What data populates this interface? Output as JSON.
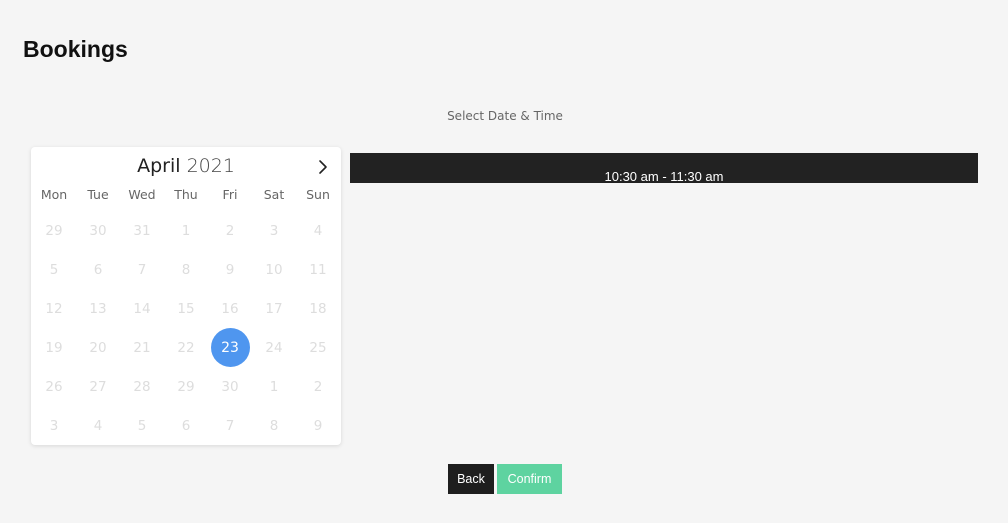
{
  "page": {
    "title": "Bookings"
  },
  "section": {
    "label": "Select Date & Time"
  },
  "calendar": {
    "month": "April",
    "year": "2021",
    "next_icon": "chevron-right-icon",
    "weekdays": [
      "Mon",
      "Tue",
      "Wed",
      "Thu",
      "Fri",
      "Sat",
      "Sun"
    ],
    "weeks": [
      [
        "29",
        "30",
        "31",
        "1",
        "2",
        "3",
        "4"
      ],
      [
        "5",
        "6",
        "7",
        "8",
        "9",
        "10",
        "11"
      ],
      [
        "12",
        "13",
        "14",
        "15",
        "16",
        "17",
        "18"
      ],
      [
        "19",
        "20",
        "21",
        "22",
        "23",
        "24",
        "25"
      ],
      [
        "26",
        "27",
        "28",
        "29",
        "30",
        "1",
        "2"
      ],
      [
        "3",
        "4",
        "5",
        "6",
        "7",
        "8",
        "9"
      ]
    ],
    "selected_day": "23",
    "selected_color": "#4f96ef"
  },
  "time_slots": [
    {
      "label": "10:30 am - 11:30 am"
    }
  ],
  "buttons": {
    "back_label": "Back",
    "confirm_label": "Confirm"
  },
  "colors": {
    "back_bg": "#1e1e1e",
    "confirm_bg": "#5ed3a0",
    "slot_bg": "#222222"
  }
}
